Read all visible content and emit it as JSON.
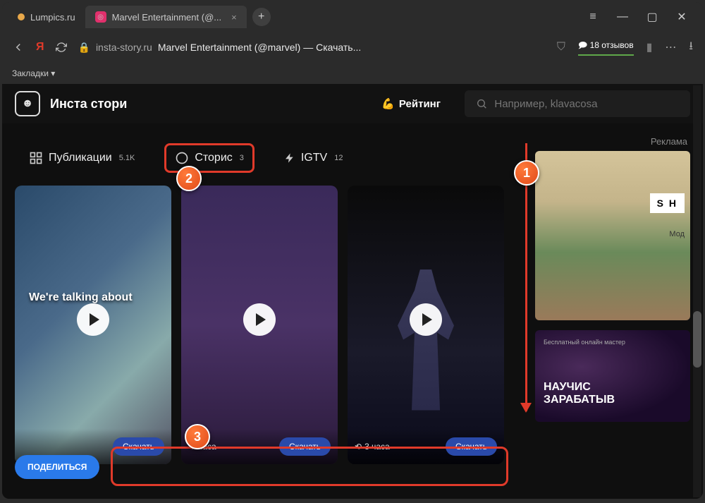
{
  "browser": {
    "tabs": [
      {
        "label": "Lumpics.ru"
      },
      {
        "label": "Marvel Entertainment (@..."
      }
    ],
    "url_domain": "insta-story.ru",
    "url_title": "Marvel Entertainment (@marvel) — Скачать...",
    "reviews": "18 отзывов",
    "bookmarks_label": "Закладки ▾"
  },
  "site": {
    "title": "Инста стори",
    "rating_label": "Рейтинг",
    "search_placeholder": "Например, klavacosa"
  },
  "tabs_nav": {
    "posts": {
      "label": "Публикации",
      "count": "5.1K"
    },
    "stories": {
      "label": "Сторис",
      "count": "3"
    },
    "igtv": {
      "label": "IGTV",
      "count": "12"
    }
  },
  "stories": [
    {
      "overlay": "We're talking about",
      "time": "",
      "download": "Скачать"
    },
    {
      "overlay": "",
      "time": "часа",
      "download": "Скачать"
    },
    {
      "overlay": "",
      "time": "3 часа",
      "download": "Скачать"
    }
  ],
  "share_label": "ПОДЕЛИТЬСЯ",
  "sidebar": {
    "ad_label": "Реклама",
    "ad1_brand": "S H",
    "ad1_sub": "Мод",
    "ad2_tag": "Бесплатный онлайн мастер",
    "ad2_headline": "НАУЧИС",
    "ad2_sub": "ЗАРАБАТЫВ"
  },
  "annotations": {
    "b1": "1",
    "b2": "2",
    "b3": "3"
  }
}
